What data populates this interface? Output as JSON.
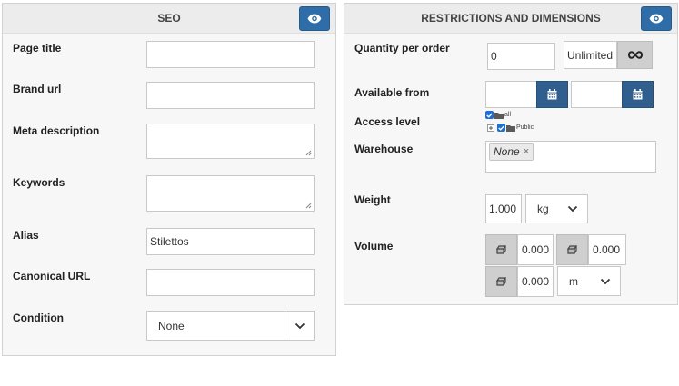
{
  "seo": {
    "title": "SEO",
    "fields": {
      "page_title": {
        "label": "Page title",
        "value": ""
      },
      "brand_url": {
        "label": "Brand url",
        "value": ""
      },
      "meta_description": {
        "label": "Meta description",
        "value": ""
      },
      "keywords": {
        "label": "Keywords",
        "value": ""
      },
      "alias": {
        "label": "Alias",
        "value": "Stilettos"
      },
      "canonical_url": {
        "label": "Canonical URL",
        "value": ""
      },
      "condition": {
        "label": "Condition",
        "value": "None"
      }
    }
  },
  "restrictions": {
    "title": "RESTRICTIONS AND DIMENSIONS",
    "quantity_per_order": {
      "label": "Quantity per order",
      "value": "0",
      "unlimited_label": "Unlimited"
    },
    "available_from": {
      "label": "Available from",
      "start": "",
      "end": ""
    },
    "access_level": {
      "label": "Access level",
      "items": [
        "all",
        "Public"
      ]
    },
    "warehouse": {
      "label": "Warehouse",
      "tag": "None",
      "tag_remove": "×"
    },
    "weight": {
      "label": "Weight",
      "value": "1.000",
      "unit": "kg"
    },
    "volume": {
      "label": "Volume",
      "x": "0.000",
      "y": "0.000",
      "z": "0.000",
      "unit": "m"
    }
  },
  "icons": {
    "eye": "eye-icon",
    "infinity": "infinity-icon",
    "calendar": "calendar-icon",
    "chevron": "chevron-down-icon",
    "folder": "folder-icon",
    "dimension": "dimension-icon"
  },
  "colors": {
    "primary_button": "#2f6da9",
    "calendar_button": "#2f5e8f",
    "checkbox": "#1f6fd1",
    "panel_bg": "#f7f7f7",
    "header_bg": "#ececec"
  }
}
